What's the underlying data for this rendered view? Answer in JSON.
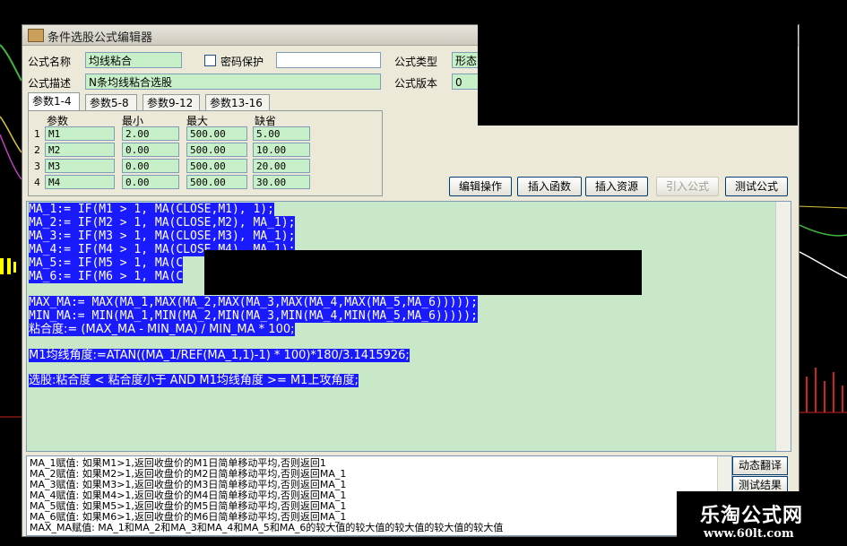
{
  "window": {
    "title": "条件选股公式编辑器"
  },
  "header": {
    "name_label": "公式名称",
    "name_value": "均线粘合",
    "password_label": "密码保护",
    "type_label": "公式类型",
    "type_value": "形态",
    "desc_label": "公式描述",
    "desc_value": "N条均线粘合选股",
    "version_label": "公式版本",
    "version_value": "0"
  },
  "tabs": [
    {
      "label": "参数1-4",
      "active": true
    },
    {
      "label": "参数5-8"
    },
    {
      "label": "参数9-12"
    },
    {
      "label": "参数13-16"
    }
  ],
  "params": {
    "headers": [
      "参数",
      "最小",
      "最大",
      "缺省"
    ],
    "rows": [
      {
        "num": "1",
        "name": "M1",
        "min": "2.00",
        "max": "500.00",
        "default": "5.00"
      },
      {
        "num": "2",
        "name": "M2",
        "min": "0.00",
        "max": "500.00",
        "default": "10.00"
      },
      {
        "num": "3",
        "name": "M3",
        "min": "0.00",
        "max": "500.00",
        "default": "20.00"
      },
      {
        "num": "4",
        "name": "M4",
        "min": "0.00",
        "max": "500.00",
        "default": "30.00"
      }
    ]
  },
  "toolbar": {
    "edit_ops": "编辑操作",
    "insert_func": "插入函数",
    "insert_res": "插入资源",
    "import_formula": "引入公式",
    "test_formula": "测试公式"
  },
  "code_lines": [
    "MA_1:= IF(M1 > 1, MA(CLOSE,M1), 1);",
    "MA_2:= IF(M2 > 1, MA(CLOSE,M2), MA_1);",
    "MA_3:= IF(M3 > 1, MA(CLOSE,M3), MA_1);",
    "MA_4:= IF(M4 > 1, MA(CLOSE,M4), MA_1);",
    "MA_5:= IF(M5 > 1, MA(C",
    "MA_6:= IF(M6 > 1, MA(C",
    "MAX_MA:= MAX(MA_1,MAX(MA_2,MAX(MA_3,MAX(MA_4,MAX(MA_5,MA_6)))));",
    "MIN_MA:= MIN(MA_1,MIN(MA_2,MIN(MA_3,MIN(MA_4,MIN(MA_5,MA_6)))));",
    "粘合度:= (MAX_MA - MIN_MA) / MIN_MA * 100;",
    "M1均线角度:=ATAN((MA_1/REF(MA_1,1)-1) * 100)*180/3.1415926;",
    "选股:粘合度 < 粘合度小于 AND M1均线角度 >= M1上攻角度;"
  ],
  "desc_lines": [
    "MA_1赋值: 如果M1>1,返回收盘价的M1日简单移动平均,否则返回1",
    "MA_2赋值: 如果M2>1,返回收盘价的M2日简单移动平均,否则返回MA_1",
    "MA_3赋值: 如果M3>1,返回收盘价的M3日简单移动平均,否则返回MA_1",
    "MA_4赋值: 如果M4>1,返回收盘价的M4日简单移动平均,否则返回MA_1",
    "MA_5赋值: 如果M5>1,返回收盘价的M5日简单移动平均,否则返回MA_1",
    "MA_6赋值: 如果M6>1,返回收盘价的M6日简单移动平均,否则返回MA_1",
    "MAX_MA赋值: MA_1和MA_2和MA_3和MA_4和MA_5和MA_6的较大值的较大值的较大值的较大值的较大值"
  ],
  "side": {
    "dynamic_translate": "动态翻译",
    "test_result": "测试结果"
  },
  "watermark": {
    "title": "乐淘公式网",
    "url": "www.60lt.com"
  },
  "colors": {
    "code_highlight": "#1a1aff",
    "editor_bg": "#c8e8c8",
    "field_bg": "#c8f0c8"
  }
}
